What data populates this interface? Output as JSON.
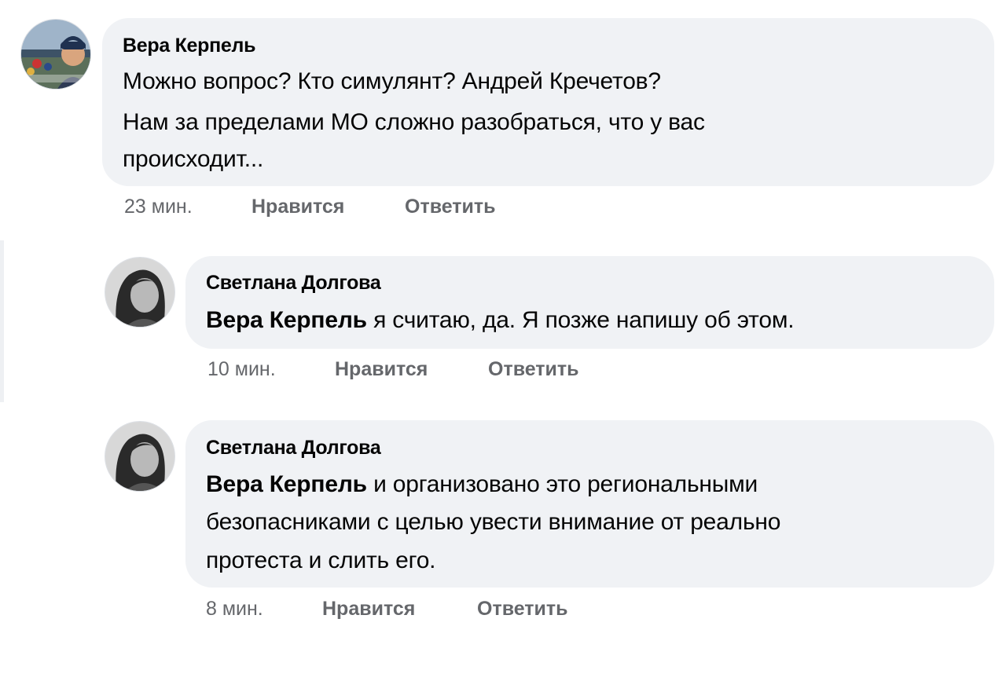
{
  "comments": [
    {
      "author": "Вера Керпель",
      "lines": [
        "Можно вопрос? Кто симулянт? Андрей Кречетов?",
        "Нам за пределами МО сложно разобраться, что у вас",
        "происходит..."
      ],
      "time": "23 мин.",
      "like_label": "Нравится",
      "reply_label": "Ответить"
    },
    {
      "author": "Светлана Долгова",
      "mention": "Вера Керпель",
      "lines": [
        "я считаю, да. Я позже напишу об этом."
      ],
      "time": "10 мин.",
      "like_label": "Нравится",
      "reply_label": "Ответить"
    },
    {
      "author": "Светлана Долгова",
      "mention": "Вера Керпель",
      "lines": [
        "и организовано это региональными",
        "безопасниками с целью увести внимание от реально",
        "протеста и слить его."
      ],
      "time": "8 мин.",
      "like_label": "Нравится",
      "reply_label": "Ответить"
    }
  ],
  "colors": {
    "bubble": "#f0f2f5",
    "text": "#050505",
    "meta": "#65676b"
  }
}
